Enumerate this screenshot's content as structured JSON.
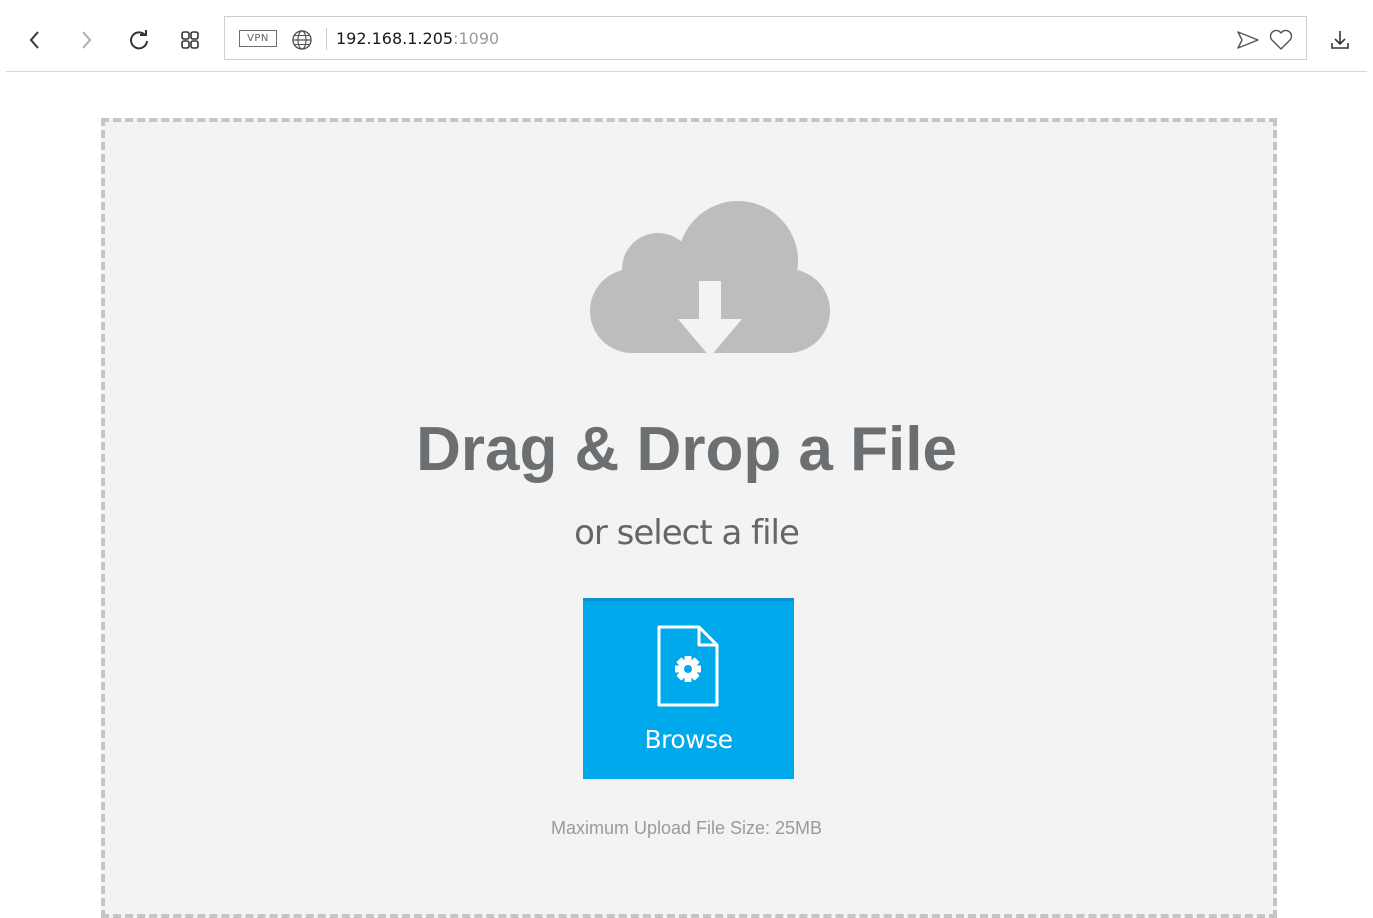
{
  "browser": {
    "vpn_label": "VPN",
    "url_host": "192.168.1.205",
    "url_port": ":1090",
    "icons": [
      "back-icon",
      "forward-icon",
      "reload-icon",
      "speed-dial-icon",
      "globe-icon",
      "send-icon",
      "heart-icon",
      "download-icon"
    ]
  },
  "upload": {
    "headline": "Drag & Drop a File",
    "subline": "or select a file",
    "browse_label": "Browse",
    "max_size_text": "Maximum Upload File Size: 25MB",
    "icons": [
      "cloud-download-icon",
      "file-settings-icon"
    ]
  },
  "colors": {
    "accent": "#00a8ec",
    "dropzone_bg": "#f3f3f3",
    "dropzone_border": "#c5c5c5",
    "headline": "#6c6f71",
    "icon_gray": "#bdbdbd"
  }
}
